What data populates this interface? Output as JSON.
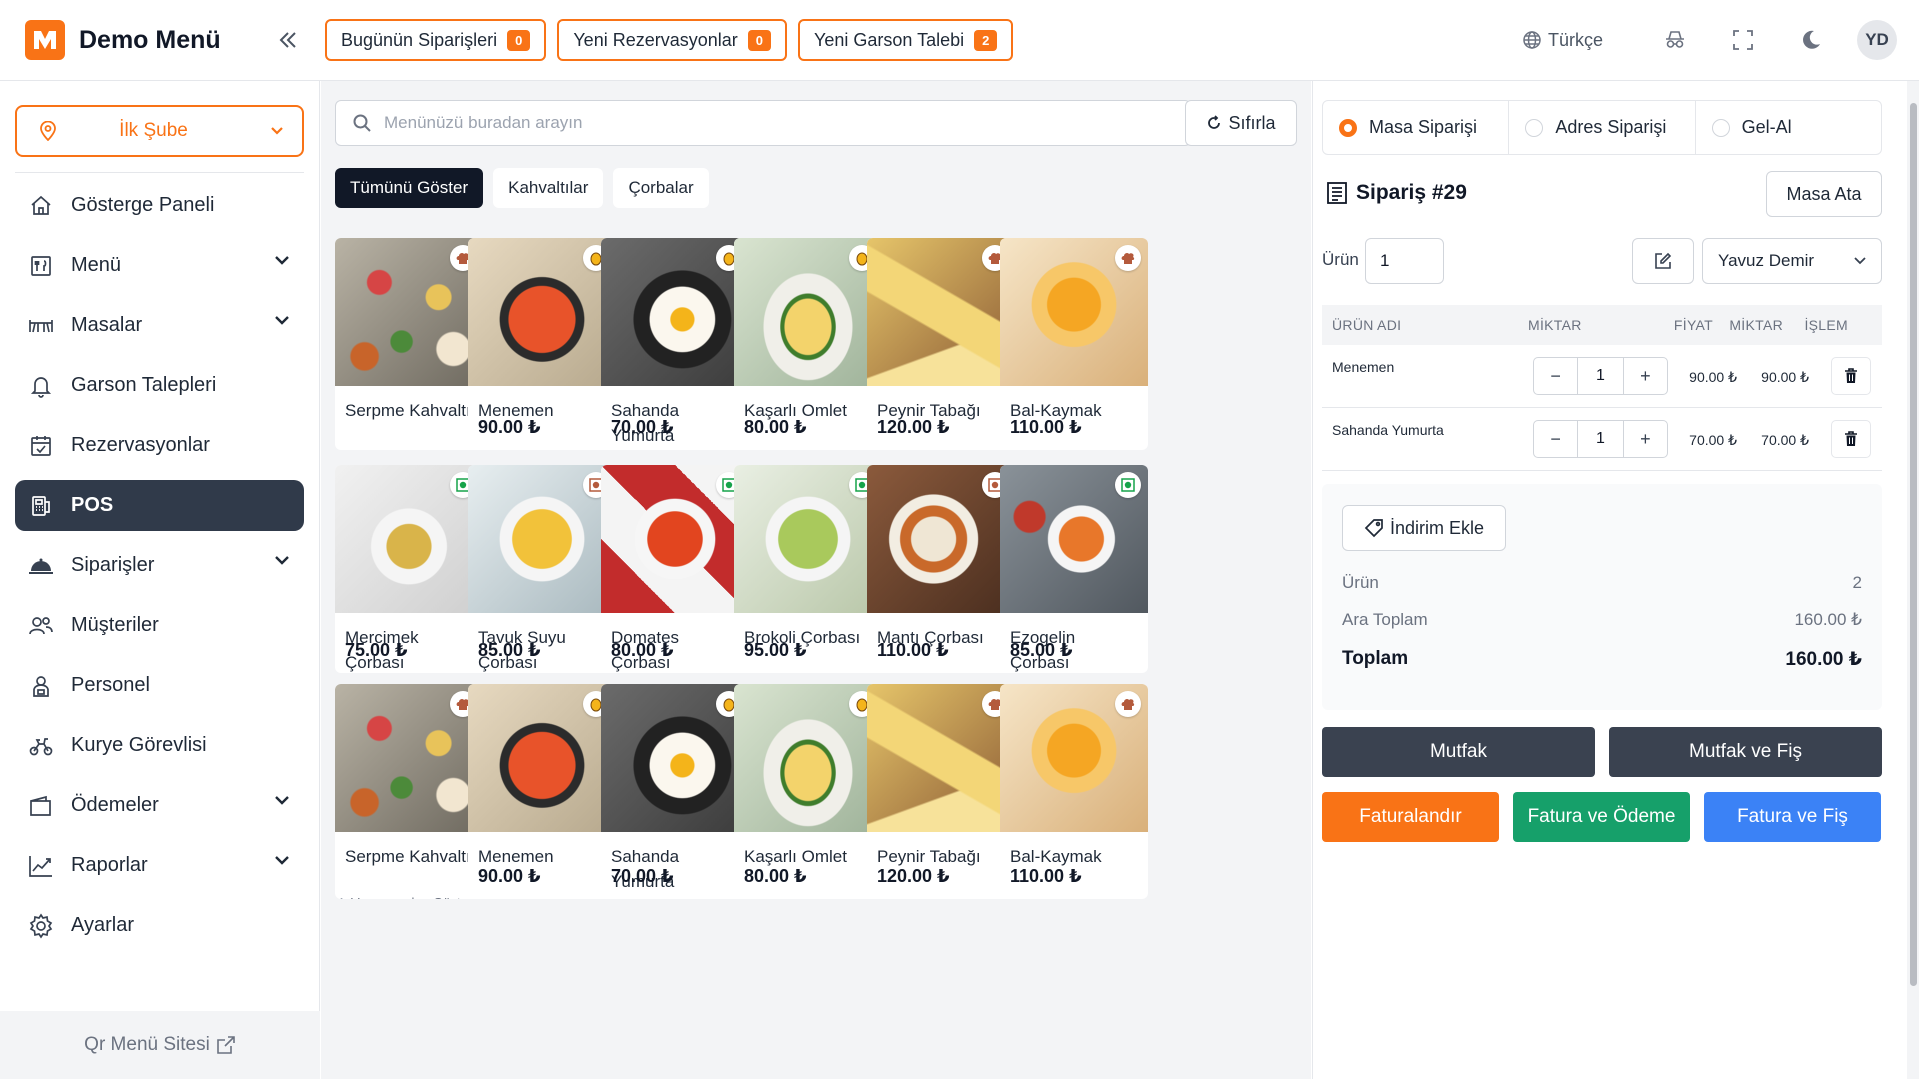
{
  "brand": {
    "title": "Demo Menü"
  },
  "header": {
    "badges": [
      {
        "label": "Bugünün Siparişleri",
        "count": "0"
      },
      {
        "label": "Yeni Rezervasyonlar",
        "count": "0"
      },
      {
        "label": "Yeni Garson Talebi",
        "count": "2"
      }
    ],
    "language": "Türkçe",
    "avatar_initials": "YD"
  },
  "sidebar": {
    "branch": "İlk Şube",
    "items": [
      {
        "label": "Gösterge Paneli",
        "icon": "home-icon"
      },
      {
        "label": "Menü",
        "icon": "menu-book-icon"
      },
      {
        "label": "Masalar",
        "icon": "table-icon"
      },
      {
        "label": "Garson Talepleri",
        "icon": "bell-icon"
      },
      {
        "label": "Rezervasyonlar",
        "icon": "calendar-check-icon"
      },
      {
        "label": "POS",
        "icon": "pos-terminal-icon"
      },
      {
        "label": "Siparişler",
        "icon": "cloche-icon"
      },
      {
        "label": "Müşteriler",
        "icon": "users-icon"
      },
      {
        "label": "Personel",
        "icon": "person-badge-icon"
      },
      {
        "label": "Kurye Görevlisi",
        "icon": "courier-icon"
      },
      {
        "label": "Ödemeler",
        "icon": "wallet-icon"
      },
      {
        "label": "Raporlar",
        "icon": "chart-line-icon"
      },
      {
        "label": "Ayarlar",
        "icon": "gear-icon"
      }
    ],
    "footer_link": "Qr Menü Sitesi"
  },
  "menu": {
    "search_placeholder": "Menünüzü buradan arayın",
    "reset_label": "Sıfırla",
    "categories": [
      "Tümünü Göster",
      "Kahvaltılar",
      "Çorbalar"
    ],
    "variants_label": "Varyasyonları Göster",
    "products": [
      {
        "name": "Serpme Kahvaltı",
        "price": "-",
        "variant": true,
        "tag": "chef"
      },
      {
        "name": "Menemen",
        "price": "90.00 ₺",
        "tag": "egg"
      },
      {
        "name": "Sahanda Yumurta",
        "price": "70.00 ₺",
        "tag": "egg"
      },
      {
        "name": "Kaşarlı Omlet",
        "price": "80.00 ₺",
        "tag": "egg"
      },
      {
        "name": "Peynir Tabağı",
        "price": "120.00 ₺",
        "tag": "chef"
      },
      {
        "name": "Bal-Kaymak",
        "price": "110.00 ₺",
        "tag": "chef"
      },
      {
        "name": "Mercimek Çorbası",
        "price": "75.00 ₺",
        "tag": "veg"
      },
      {
        "name": "Tavuk Suyu Çorbası",
        "price": "85.00 ₺",
        "tag": "nonveg"
      },
      {
        "name": "Domates Çorbası",
        "price": "80.00 ₺",
        "tag": "veg"
      },
      {
        "name": "Brokoli Çorbası",
        "price": "95.00 ₺",
        "tag": "veg"
      },
      {
        "name": "Mantı Çorbası",
        "price": "110.00 ₺",
        "tag": "nonveg"
      },
      {
        "name": "Ezogelin Çorbası",
        "price": "85.00 ₺",
        "tag": "veg"
      },
      {
        "name": "Serpme Kahvaltı",
        "price": "-",
        "variant": true,
        "tag": "chef"
      },
      {
        "name": "Menemen",
        "price": "90.00 ₺",
        "tag": "egg"
      },
      {
        "name": "Sahanda Yumurta",
        "price": "70.00 ₺",
        "tag": "egg"
      },
      {
        "name": "Kaşarlı Omlet",
        "price": "80.00 ₺",
        "tag": "egg"
      },
      {
        "name": "Peynir Tabağı",
        "price": "120.00 ₺",
        "tag": "chef"
      },
      {
        "name": "Bal-Kaymak",
        "price": "110.00 ₺",
        "tag": "chef"
      }
    ]
  },
  "order": {
    "types": [
      {
        "label": "Masa Siparişi",
        "checked": true
      },
      {
        "label": "Adres Siparişi",
        "checked": false
      },
      {
        "label": "Gel-Al",
        "checked": false
      }
    ],
    "title": "Sipariş #29",
    "assign_table_label": "Masa Ata",
    "qty_label": "Ürün",
    "qty_value": "1",
    "waiter": "Yavuz Demir",
    "columns": [
      "ÜRÜN ADI",
      "MİKTAR",
      "FİYAT",
      "MİKTAR",
      "İŞLEM"
    ],
    "lines": [
      {
        "name": "Menemen",
        "qty": "1",
        "price": "90.00 ₺",
        "total": "90.00 ₺"
      },
      {
        "name": "Sahanda Yumurta",
        "qty": "1",
        "price": "70.00 ₺",
        "total": "70.00 ₺"
      }
    ],
    "discount_label": "İndirim Ekle",
    "summary": {
      "items_label": "Ürün",
      "items_value": "2",
      "subtotal_label": "Ara Toplam",
      "subtotal_value": "160.00 ₺",
      "total_label": "Toplam",
      "total_value": "160.00 ₺"
    },
    "actions": {
      "kitchen": "Mutfak",
      "kitchen_receipt": "Mutfak ve Fiş",
      "invoice": "Faturalandır",
      "invoice_payment": "Fatura ve Ödeme",
      "invoice_receipt": "Fatura ve Fiş"
    }
  },
  "colors": {
    "accent": "#f97316",
    "dark": "#303a4a",
    "green": "#16a06a",
    "blue": "#3b82f6"
  }
}
